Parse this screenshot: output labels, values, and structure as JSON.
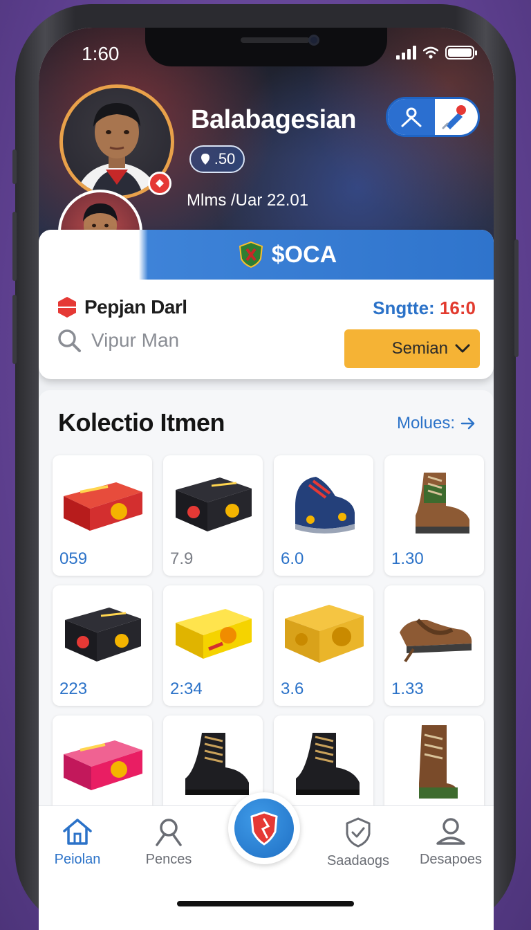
{
  "status": {
    "time": "1:60"
  },
  "profile": {
    "name": "Balabagesian",
    "rating": ".50",
    "meta": "Mlms /Uar 22.01"
  },
  "banner": {
    "label": "$OCA"
  },
  "player": {
    "name": "Pepjan Darl",
    "stat_label": "Sngtte:",
    "stat_value": "16:0"
  },
  "search": {
    "placeholder": "Vipur Man"
  },
  "sort": {
    "label": "Semian"
  },
  "collection": {
    "title": "Kolectio Itmen",
    "more_label": "Molues:",
    "items": [
      {
        "kind": "box-red",
        "price": "059"
      },
      {
        "kind": "box-black",
        "price": "7.9"
      },
      {
        "kind": "shoe-blue",
        "price": "6.0"
      },
      {
        "kind": "boot-brown-green",
        "price": "1.30"
      },
      {
        "kind": "box-black",
        "price": "223"
      },
      {
        "kind": "box-yellow",
        "price": "2:34"
      },
      {
        "kind": "box-gold",
        "price": "3.6"
      },
      {
        "kind": "shoe-brown",
        "price": "1.33"
      },
      {
        "kind": "box-pink",
        "price": ""
      },
      {
        "kind": "boot-black",
        "price": ""
      },
      {
        "kind": "boot-black",
        "price": ""
      },
      {
        "kind": "boot-tall-brown",
        "price": ""
      }
    ]
  },
  "nav": {
    "items": [
      {
        "label": "Peiolan",
        "icon": "home-icon"
      },
      {
        "label": "Pences",
        "icon": "user-icon"
      },
      {
        "label": "Saadaogs",
        "icon": "shield-check-icon"
      },
      {
        "label": "Desapoes",
        "icon": "users-icon"
      }
    ]
  },
  "colors": {
    "accent_blue": "#2b72c8",
    "accent_orange": "#f5b335",
    "alert_red": "#e23a2e"
  }
}
